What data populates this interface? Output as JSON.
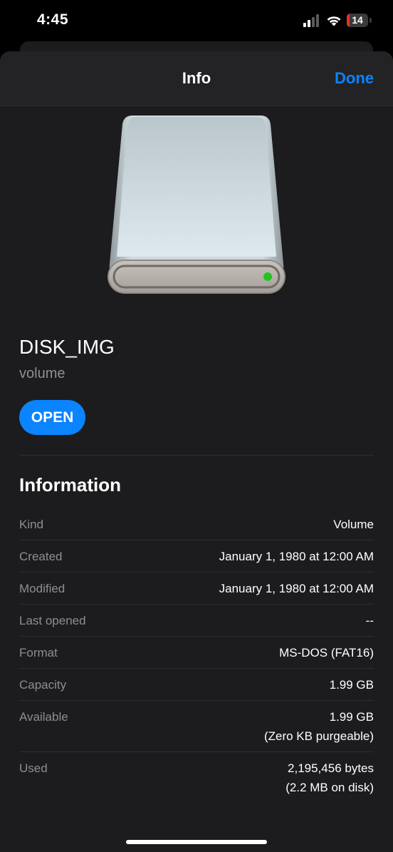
{
  "status_bar": {
    "time": "4:45",
    "battery_level": "14",
    "battery_color": "#e5332a"
  },
  "nav": {
    "title": "Info",
    "done_label": "Done",
    "accent_color": "#0a84ff"
  },
  "item": {
    "icon": "external-drive-icon",
    "name": "DISK_IMG",
    "kind": "volume",
    "open_label": "OPEN"
  },
  "information": {
    "title": "Information",
    "rows": [
      {
        "label": "Kind",
        "value": "Volume",
        "value2": ""
      },
      {
        "label": "Created",
        "value": "January 1, 1980 at 12:00 AM",
        "value2": ""
      },
      {
        "label": "Modified",
        "value": "January 1, 1980 at 12:00 AM",
        "value2": ""
      },
      {
        "label": "Last opened",
        "value": "--",
        "value2": ""
      },
      {
        "label": "Format",
        "value": "MS-DOS (FAT16)",
        "value2": ""
      },
      {
        "label": "Capacity",
        "value": "1.99 GB",
        "value2": ""
      },
      {
        "label": "Available",
        "value": "1.99 GB",
        "value2": "(Zero KB purgeable)"
      },
      {
        "label": "Used",
        "value": "2,195,456 bytes",
        "value2": "(2.2 MB on disk)"
      }
    ]
  }
}
